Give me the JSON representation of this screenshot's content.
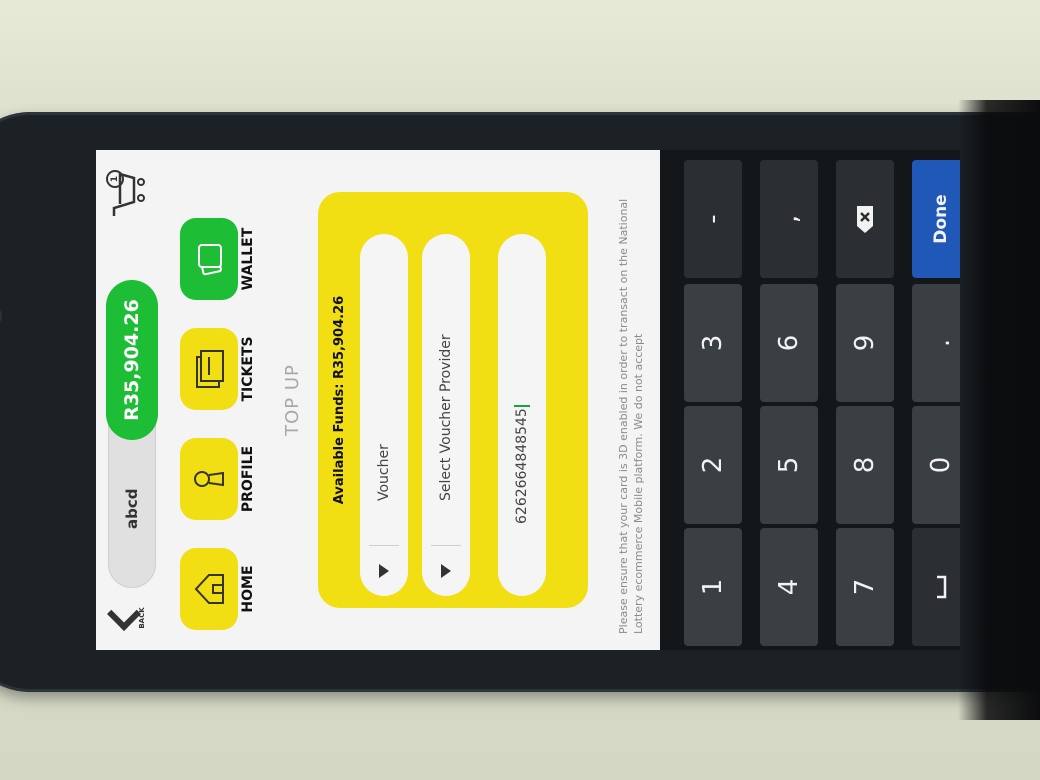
{
  "header": {
    "back_label": "BACK",
    "username": "abcd",
    "balance": "R35,904.26",
    "cart_count": "1"
  },
  "nav": {
    "items": [
      {
        "label": "HOME",
        "color": "#f1de13"
      },
      {
        "label": "PROFILE",
        "color": "#f1de13"
      },
      {
        "label": "TICKETS",
        "color": "#f1de13"
      },
      {
        "label": "WALLET",
        "color": "#1dbd36"
      }
    ]
  },
  "page": {
    "title": "TOP UP"
  },
  "form": {
    "available_funds": "Available Funds: R35,904.26",
    "payment_type": "Voucher",
    "provider_placeholder": "Select Voucher Provider",
    "voucher_number": "6262664848545"
  },
  "notice": "Please ensure that your card is 3D enabled in order to transact on the National Lottery ecommerce Mobile platform. We do not accept",
  "keypad": {
    "keys": [
      "1",
      "2",
      "3",
      "-",
      "4",
      "5",
      "6",
      ",",
      "7",
      "8",
      "9",
      "⌫",
      "␣",
      "0",
      ".",
      "Done"
    ]
  }
}
